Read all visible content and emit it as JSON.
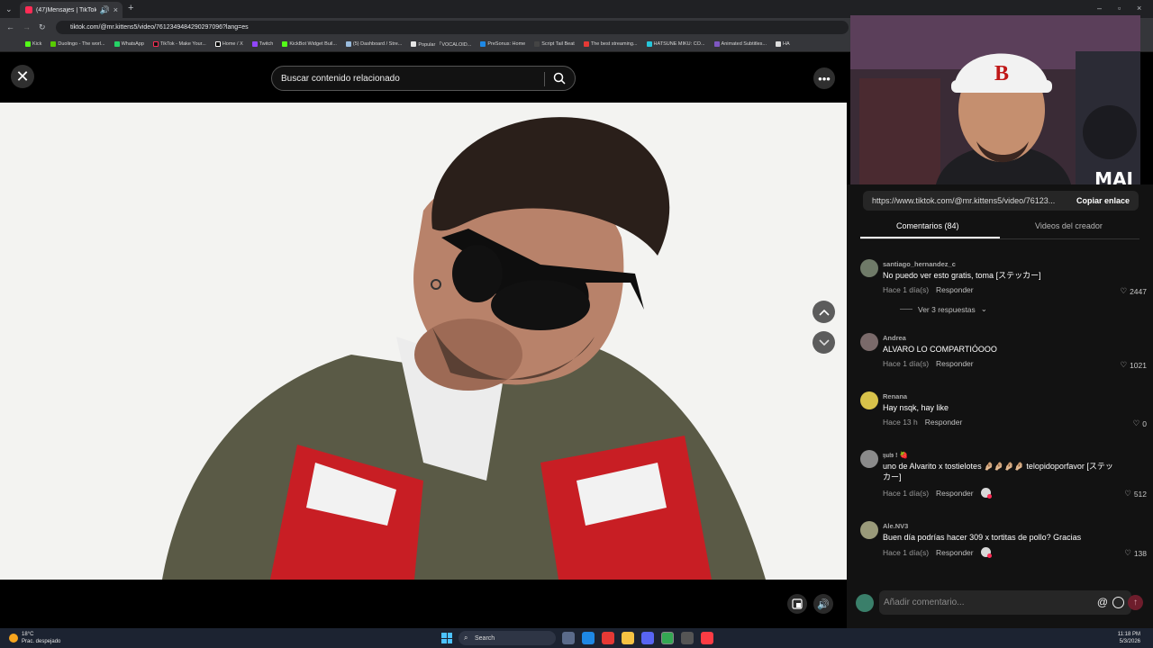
{
  "browser": {
    "tab_title": "(47)Mensajes | TikTok",
    "url": "tiktok.com/@mr.kittens5/video/7612349484290297096?lang=es",
    "bookmarks": [
      "Kick",
      "Duolingo - The worl...",
      "WhatsApp",
      "TikTok - Make Your...",
      "Home / X",
      "Twitch",
      "KickBot Widget Buil...",
      "(5) Dashboard / Stre...",
      "Popular 「VOCALOID...",
      "PreSonus: Home",
      "Script Tail Beat",
      "The best streaming...",
      "HATSUNE MIKU: CO...",
      "Animated Subtitles...",
      "HA"
    ]
  },
  "viewer": {
    "search_placeholder": "Buscar contenido relacionado"
  },
  "stream_overlay": {
    "label": "MAI"
  },
  "panel": {
    "link": "https://www.tiktok.com/@mr.kittens5/video/76123...",
    "copy_label": "Copiar enlace",
    "tab_comments": "Comentarios (84)",
    "tab_videos": "Videos del creador",
    "comments": [
      {
        "user": "santiago_hernandez_c",
        "text": "No puedo ver esto gratis, toma [ステッカー]",
        "time": "Hace 1 día(s)",
        "reply": "Responder",
        "likes": "2447",
        "replies": "Ver 3 respuestas"
      },
      {
        "user": "Andrea",
        "text": "ALVARO LO COMPARTIÓOOO",
        "time": "Hace 1 día(s)",
        "reply": "Responder",
        "likes": "1021"
      },
      {
        "user": "Renana",
        "text": "Hay nsqk, hay like",
        "time": "Hace 13 h",
        "reply": "Responder",
        "likes": "0"
      },
      {
        "user": "𝔶𝔲𝔦𝔰 ! 🍓",
        "text": "uno de Alvarito x tostielotes 🤌🏼🤌🏼🤌🏼🤌🏼 telopidoporfavor [ステッカー]",
        "time": "Hace 1 día(s)",
        "reply": "Responder",
        "likes": "512"
      },
      {
        "user": "Ale.NV3",
        "text": "Buen día podrías hacer 309 x tortitas de pollo? Gracias",
        "time": "Hace 1 día(s)",
        "reply": "Responder",
        "likes": "138"
      }
    ],
    "comment_placeholder": "Añadir comentario..."
  },
  "taskbar": {
    "temp": "18°C",
    "weather": "Prac. despejado",
    "search": "Search",
    "time": "11:18 PM",
    "date": "5/3/2026"
  }
}
